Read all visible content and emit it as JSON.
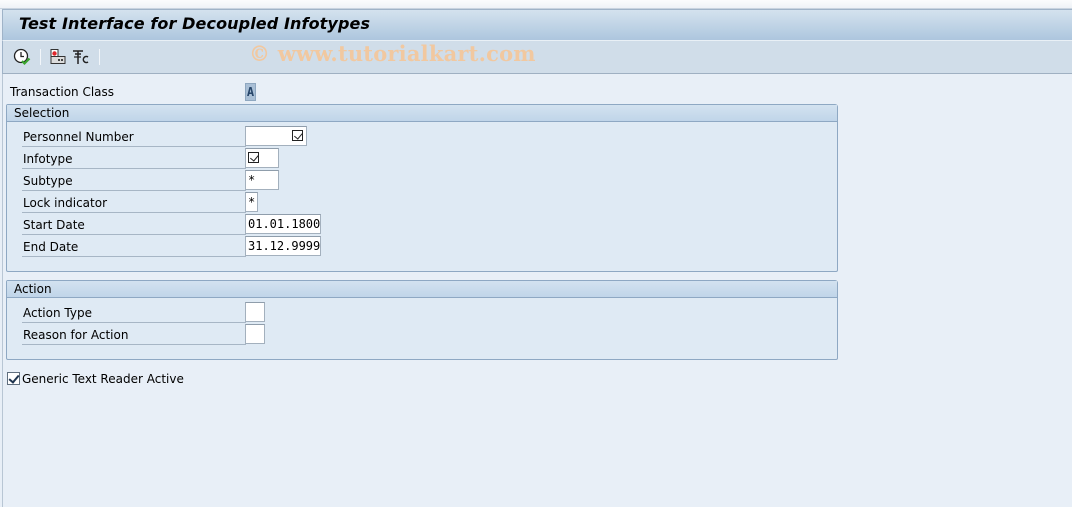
{
  "window": {
    "title": "Test Interface for Decoupled Infotypes",
    "watermark": "© www.tutorialkart.com"
  },
  "toolbar": {
    "buttons": [
      {
        "name": "execute",
        "icon": "clock-check-icon"
      },
      {
        "name": "get-variant",
        "icon": "variant-icon"
      },
      {
        "name": "settings",
        "icon": "tools-icon"
      }
    ]
  },
  "header_fields": {
    "transaction_class": {
      "label": "Transaction Class",
      "value": "A"
    }
  },
  "selection": {
    "title": "Selection",
    "fields": [
      {
        "label": "Personnel Number",
        "value": "",
        "required_marker": true
      },
      {
        "label": "Infotype",
        "value": "",
        "required_marker": true
      },
      {
        "label": "Subtype",
        "value": "*"
      },
      {
        "label": "Lock indicator",
        "value": "*"
      },
      {
        "label": "Start Date",
        "value": "01.01.1800"
      },
      {
        "label": "End Date",
        "value": "31.12.9999"
      }
    ]
  },
  "action": {
    "title": "Action",
    "fields": [
      {
        "label": "Action Type",
        "value": ""
      },
      {
        "label": "Reason for Action",
        "value": ""
      }
    ]
  },
  "options": {
    "generic_text_reader": {
      "label": "Generic Text Reader Active",
      "checked": true
    }
  }
}
